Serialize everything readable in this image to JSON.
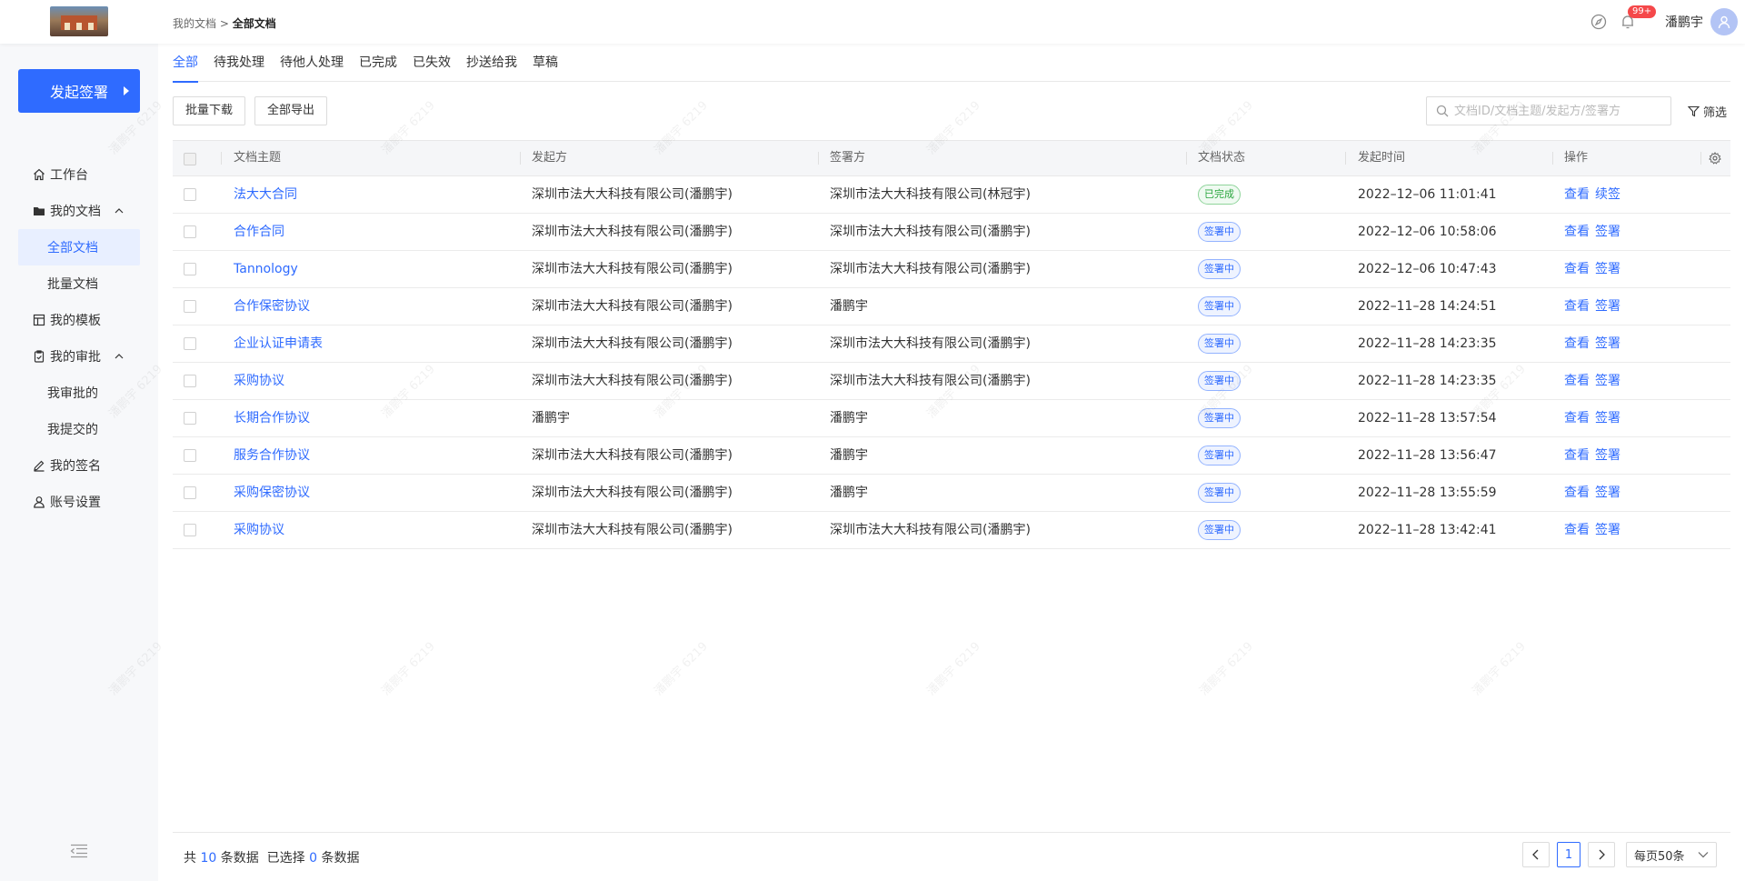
{
  "header": {
    "breadcrumb_parent": "我的文档",
    "breadcrumb_sep": ">",
    "breadcrumb_current": "全部文档",
    "notification_count": "99+",
    "username": "潘鹏宇"
  },
  "sidebar": {
    "start_button": "发起签署",
    "items": {
      "workbench": "工作台",
      "my_docs": "我的文档",
      "all_docs": "全部文档",
      "batch_docs": "批量文档",
      "my_templates": "我的模板",
      "my_approval": "我的审批",
      "approved_by_me": "我审批的",
      "submitted_by_me": "我提交的",
      "my_signature": "我的签名",
      "account_settings": "账号设置"
    }
  },
  "tabs": [
    "全部",
    "待我处理",
    "待他人处理",
    "已完成",
    "已失效",
    "抄送给我",
    "草稿"
  ],
  "toolbar": {
    "batch_download": "批量下载",
    "export_all": "全部导出",
    "search_placeholder": "文档ID/文档主题/发起方/签署方",
    "filter": "筛选"
  },
  "table": {
    "columns": {
      "subject": "文档主题",
      "initiator": "发起方",
      "signer": "签署方",
      "status": "文档状态",
      "time": "发起时间",
      "actions": "操作"
    },
    "rows": [
      {
        "subject": "法大大合同",
        "initiator": "深圳市法大大科技有限公司(潘鹏宇)",
        "signer": "深圳市法大大科技有限公司(林冠宇)",
        "status": "已完成",
        "status_type": "done",
        "time": "2022–12–06 11:01:41",
        "op1": "查看",
        "op2": "续签"
      },
      {
        "subject": "合作合同",
        "initiator": "深圳市法大大科技有限公司(潘鹏宇)",
        "signer": "深圳市法大大科技有限公司(潘鹏宇)",
        "status": "签署中",
        "status_type": "signing",
        "time": "2022–12–06 10:58:06",
        "op1": "查看",
        "op2": "签署"
      },
      {
        "subject": "Tannology",
        "initiator": "深圳市法大大科技有限公司(潘鹏宇)",
        "signer": "深圳市法大大科技有限公司(潘鹏宇)",
        "status": "签署中",
        "status_type": "signing",
        "time": "2022–12–06 10:47:43",
        "op1": "查看",
        "op2": "签署"
      },
      {
        "subject": "合作保密协议",
        "initiator": "深圳市法大大科技有限公司(潘鹏宇)",
        "signer": "潘鹏宇",
        "status": "签署中",
        "status_type": "signing",
        "time": "2022–11–28 14:24:51",
        "op1": "查看",
        "op2": "签署"
      },
      {
        "subject": "企业认证申请表",
        "initiator": "深圳市法大大科技有限公司(潘鹏宇)",
        "signer": "深圳市法大大科技有限公司(潘鹏宇)",
        "status": "签署中",
        "status_type": "signing",
        "time": "2022–11–28 14:23:35",
        "op1": "查看",
        "op2": "签署"
      },
      {
        "subject": "采购协议",
        "initiator": "深圳市法大大科技有限公司(潘鹏宇)",
        "signer": "深圳市法大大科技有限公司(潘鹏宇)",
        "status": "签署中",
        "status_type": "signing",
        "time": "2022–11–28 14:23:35",
        "op1": "查看",
        "op2": "签署"
      },
      {
        "subject": "长期合作协议",
        "initiator": "潘鹏宇",
        "signer": "潘鹏宇",
        "status": "签署中",
        "status_type": "signing",
        "time": "2022–11–28 13:57:54",
        "op1": "查看",
        "op2": "签署"
      },
      {
        "subject": "服务合作协议",
        "initiator": "深圳市法大大科技有限公司(潘鹏宇)",
        "signer": "潘鹏宇",
        "status": "签署中",
        "status_type": "signing",
        "time": "2022–11–28 13:56:47",
        "op1": "查看",
        "op2": "签署"
      },
      {
        "subject": "采购保密协议",
        "initiator": "深圳市法大大科技有限公司(潘鹏宇)",
        "signer": "潘鹏宇",
        "status": "签署中",
        "status_type": "signing",
        "time": "2022–11–28 13:55:59",
        "op1": "查看",
        "op2": "签署"
      },
      {
        "subject": "采购协议",
        "initiator": "深圳市法大大科技有限公司(潘鹏宇)",
        "signer": "深圳市法大大科技有限公司(潘鹏宇)",
        "status": "签署中",
        "status_type": "signing",
        "time": "2022–11–28 13:42:41",
        "op1": "查看",
        "op2": "签署"
      }
    ]
  },
  "footer": {
    "total_prefix": "共",
    "total_count": "10",
    "total_suffix": "条数据",
    "selected_prefix": "已选择",
    "selected_count": "0",
    "selected_suffix": "条数据",
    "current_page": "1",
    "page_size": "每页50条"
  },
  "watermark": "潘鹏宇 6219",
  "colors": {
    "accent": "#2f6bff",
    "done": "#2aa63e",
    "badge": "#f5484a"
  }
}
